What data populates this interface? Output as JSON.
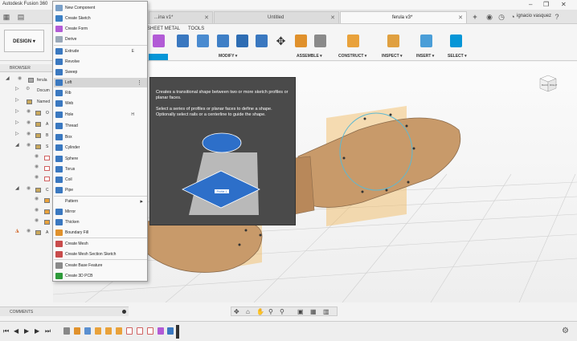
{
  "window": {
    "title": "Autodesk Fusion 360",
    "controls": [
      "–",
      "❐",
      "✕"
    ]
  },
  "tabs": [
    {
      "label": "...ina v1*"
    },
    {
      "label": "Untitled"
    },
    {
      "label": "ferula v3*"
    }
  ],
  "user_name": "ignacio vasquez",
  "ribbon": {
    "workspace": "DESIGN",
    "tabs": [
      "SHEET METAL",
      "TOOLS"
    ],
    "groups": [
      "MODIFY",
      "ASSEMBLE",
      "CONSTRUCT",
      "INSPECT",
      "INSERT",
      "SELECT"
    ]
  },
  "browser": {
    "title": "BROWSER",
    "items": [
      {
        "label": "ferula"
      },
      {
        "label": "Docum"
      },
      {
        "label": "Named"
      },
      {
        "label": "O"
      },
      {
        "label": "A"
      },
      {
        "label": "B"
      },
      {
        "label": "S"
      },
      {
        "label": "C"
      },
      {
        "label": "A"
      }
    ]
  },
  "create_menu": {
    "items": [
      {
        "label": "New Component",
        "icon": "new-component-icon",
        "color": "#7aa0c8"
      },
      {
        "label": "Create Sketch",
        "icon": "create-sketch-icon",
        "color": "#3b7fc4"
      },
      {
        "label": "Create Form",
        "icon": "create-form-icon",
        "color": "#b25bd6"
      },
      {
        "label": "Derive",
        "icon": "derive-icon",
        "color": "#9aa8b8"
      },
      {
        "label": "Extrude",
        "shortcut": "E",
        "icon": "extrude-icon",
        "color": "#3a78c0"
      },
      {
        "label": "Revolve",
        "icon": "revolve-icon",
        "color": "#3a78c0"
      },
      {
        "label": "Sweep",
        "icon": "sweep-icon",
        "color": "#3a78c0"
      },
      {
        "label": "Loft",
        "icon": "loft-icon",
        "color": "#3a78c0",
        "highlighted": true
      },
      {
        "label": "Rib",
        "icon": "rib-icon",
        "color": "#3a78c0"
      },
      {
        "label": "Web",
        "icon": "web-icon",
        "color": "#3a78c0"
      },
      {
        "label": "Hole",
        "shortcut": "H",
        "icon": "hole-icon",
        "color": "#3a78c0"
      },
      {
        "label": "Thread",
        "icon": "thread-icon",
        "color": "#3a78c0"
      },
      {
        "label": "Box",
        "icon": "box-icon",
        "color": "#3a78c0"
      },
      {
        "label": "Cylinder",
        "icon": "cylinder-icon",
        "color": "#3a78c0"
      },
      {
        "label": "Sphere",
        "icon": "sphere-icon",
        "color": "#3a78c0"
      },
      {
        "label": "Torus",
        "icon": "torus-icon",
        "color": "#3a78c0"
      },
      {
        "label": "Coil",
        "icon": "coil-icon",
        "color": "#3a78c0"
      },
      {
        "label": "Pipe",
        "icon": "pipe-icon",
        "color": "#3a78c0"
      },
      {
        "label": "Pattern",
        "icon": "",
        "color": "",
        "submenu": true
      },
      {
        "label": "Mirror",
        "icon": "mirror-icon",
        "color": "#3a78c0"
      },
      {
        "label": "Thicken",
        "icon": "thicken-icon",
        "color": "#3a78c0"
      },
      {
        "label": "Boundary Fill",
        "icon": "boundary-fill-icon",
        "color": "#e0912c"
      },
      {
        "label": "Create Mesh",
        "icon": "create-mesh-icon",
        "color": "#c84b4b"
      },
      {
        "label": "Create Mesh Section Sketch",
        "icon": "mesh-section-sketch-icon",
        "color": "#c84b4b"
      },
      {
        "label": "Create Base Feature",
        "icon": "base-feature-icon",
        "color": "#8a8a8a"
      },
      {
        "label": "Create 3D PCB",
        "icon": "pcb-icon",
        "color": "#2e9a3a"
      }
    ]
  },
  "tooltip": {
    "paragraph1": "Creates a transitional shape between two or more sketch profiles or planar faces.",
    "paragraph2": "Select a series of profiles or planar faces to define a shape. Optionally select rails or a centerline to guide the shape.",
    "illustration_label": "Profile 1"
  },
  "viewcube": {
    "face_left": "BACK",
    "face_right": "RIGHT"
  },
  "comments_label": "COMMENTS",
  "colors": {
    "accent": "#0696d7",
    "model": "#c89a6a",
    "plane": "#f2b85c",
    "menu_highlight": "#d6d6d6"
  }
}
